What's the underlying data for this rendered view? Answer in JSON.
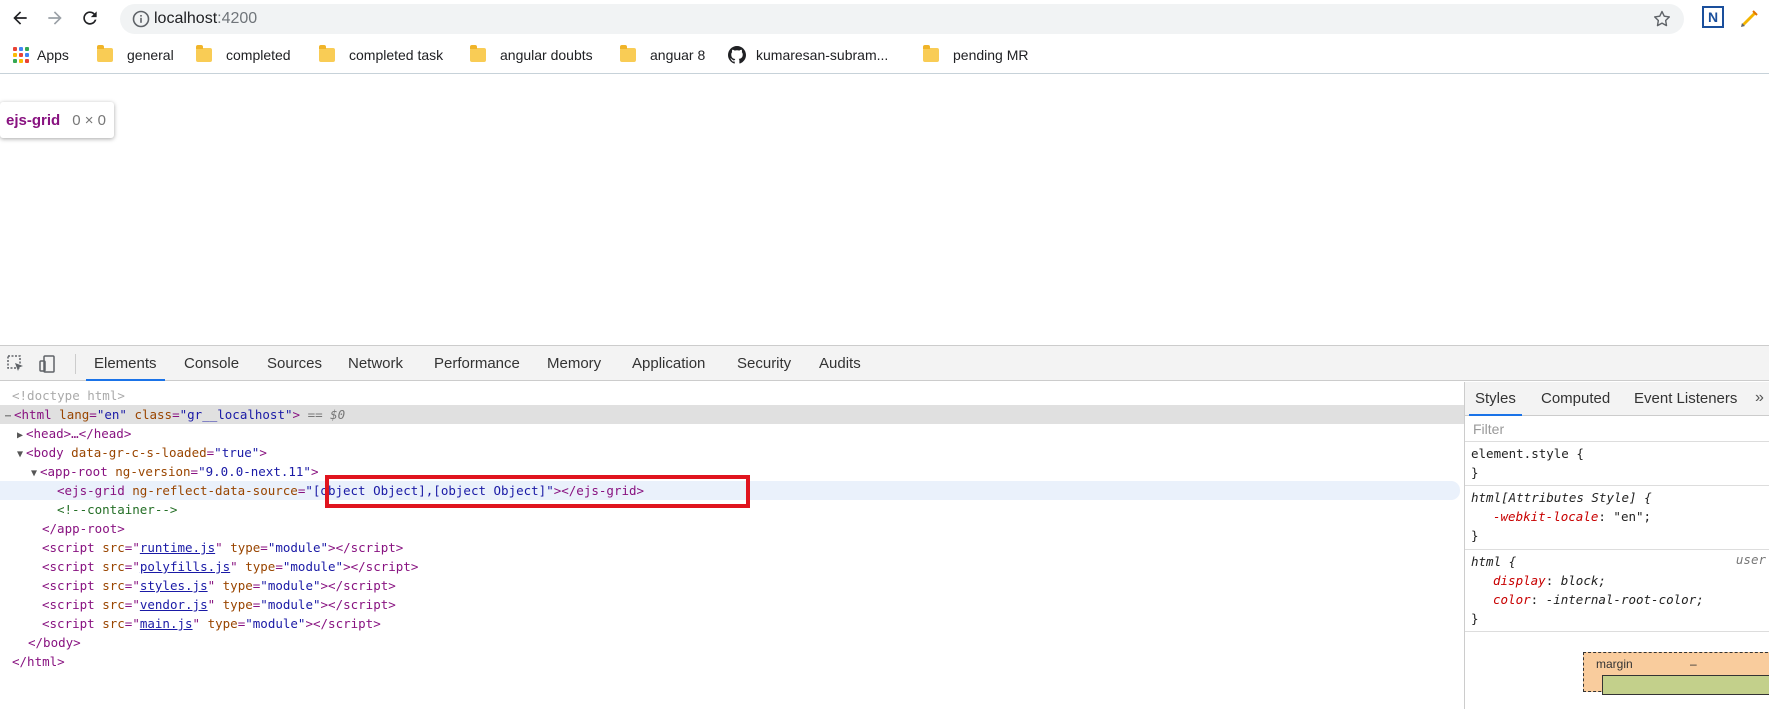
{
  "browser": {
    "url_host": "localhost",
    "url_port": ":4200"
  },
  "bookmarks": {
    "apps_label": "Apps",
    "items": [
      "general",
      "completed",
      "completed task",
      "angular doubts",
      "anguar 8"
    ],
    "github_label": "kumaresan-subram...",
    "last_label": "pending MR"
  },
  "tooltip": {
    "tag": "ejs-grid",
    "size": "0 × 0"
  },
  "devtools": {
    "tabs": [
      "Elements",
      "Console",
      "Sources",
      "Network",
      "Performance",
      "Memory",
      "Application",
      "Security",
      "Audits"
    ],
    "active_tab": "Elements",
    "dom": {
      "doctype": "<!doctype html>",
      "html_open_tag": "<html",
      "html_lang_attr": "lang",
      "html_lang_val": "\"en\"",
      "html_class_attr": "class",
      "html_class_val": "\"gr__localhost\"",
      "html_close_bracket": ">",
      "selected_marker": " == $0",
      "head": "<head>…</head>",
      "body_open": "<body",
      "body_attr": "data-gr-c-s-loaded",
      "body_val": "\"true\"",
      "app_root_open": "<app-root",
      "app_root_attr": "ng-version",
      "app_root_val": "\"9.0.0-next.11\"",
      "ejs_open": "<ejs-grid",
      "ejs_attr": "ng-reflect-data-source",
      "ejs_val": "\"[object Object],[object Object]\"",
      "ejs_close": "></ejs-grid>",
      "comment": "<!--container-->",
      "app_root_close": "</app-root>",
      "scripts": [
        {
          "src": "runtime.js",
          "type": "\"module\""
        },
        {
          "src": "polyfills.js",
          "type": "\"module\""
        },
        {
          "src": "styles.js",
          "type": "\"module\""
        },
        {
          "src": "vendor.js",
          "type": "\"module\""
        },
        {
          "src": "main.js",
          "type": "\"module\""
        }
      ],
      "body_close": "</body>",
      "html_close": "</html>"
    },
    "styles": {
      "tabs": [
        "Styles",
        "Computed",
        "Event Listeners"
      ],
      "more": "»",
      "filter_placeholder": "Filter",
      "element_style": "element.style {",
      "close_brace": "}",
      "attr_selector": "html[Attributes Style] {",
      "webkit_locale_prop": "-webkit-locale",
      "webkit_locale_val": "\"en\";",
      "html_selector": "html {",
      "user_agent": "user",
      "display_prop": "display",
      "display_val": "block;",
      "color_prop": "color",
      "color_val": "-internal-root-color;",
      "margin_label": "margin",
      "margin_value": "–"
    }
  },
  "colors": {
    "accent": "#1a73e8",
    "highlight_box": "#e0141e",
    "tag": "#881280",
    "attr_name": "#994500",
    "attr_value": "#1a1aa6"
  }
}
